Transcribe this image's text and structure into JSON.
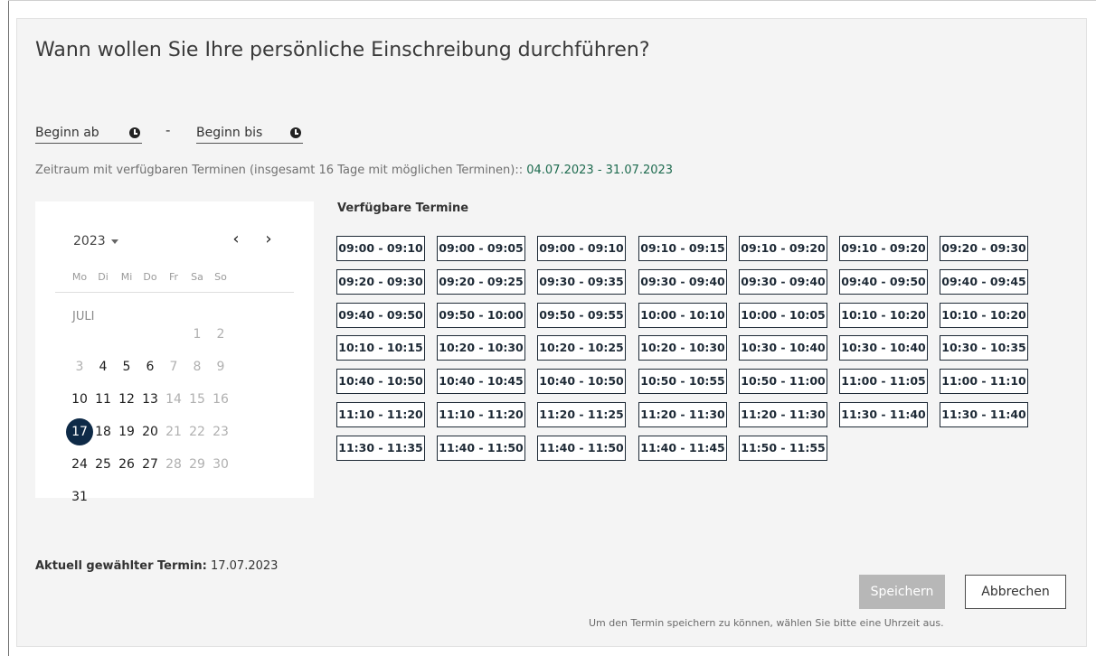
{
  "heading": "Wann wollen Sie Ihre persönliche Einschreibung durchführen?",
  "time_filter": {
    "from_label": "Beginn ab",
    "to_label": "Beginn bis",
    "separator": "-"
  },
  "range_info": {
    "text": "Zeitraum mit verfügbaren Terminen (insgesamt 16 Tage mit möglichen Terminen)::",
    "range": " 04.07.2023 - 31.07.2023"
  },
  "calendar": {
    "year": "2023",
    "prev": "‹",
    "next": "›",
    "weekdays": [
      "Mo",
      "Di",
      "Mi",
      "Do",
      "Fr",
      "Sa",
      "So"
    ],
    "month": "JULI",
    "days": [
      {
        "d": "1",
        "status": "unavailable"
      },
      {
        "d": "2",
        "status": "unavailable"
      },
      {
        "d": "3",
        "status": "unavailable"
      },
      {
        "d": "4",
        "status": "available"
      },
      {
        "d": "5",
        "status": "available"
      },
      {
        "d": "6",
        "status": "available"
      },
      {
        "d": "7",
        "status": "unavailable"
      },
      {
        "d": "8",
        "status": "unavailable"
      },
      {
        "d": "9",
        "status": "unavailable"
      },
      {
        "d": "10",
        "status": "available"
      },
      {
        "d": "11",
        "status": "available"
      },
      {
        "d": "12",
        "status": "available"
      },
      {
        "d": "13",
        "status": "available"
      },
      {
        "d": "14",
        "status": "unavailable"
      },
      {
        "d": "15",
        "status": "unavailable"
      },
      {
        "d": "16",
        "status": "unavailable"
      },
      {
        "d": "17",
        "status": "selected"
      },
      {
        "d": "18",
        "status": "available"
      },
      {
        "d": "19",
        "status": "available"
      },
      {
        "d": "20",
        "status": "available"
      },
      {
        "d": "21",
        "status": "unavailable"
      },
      {
        "d": "22",
        "status": "unavailable"
      },
      {
        "d": "23",
        "status": "unavailable"
      },
      {
        "d": "24",
        "status": "available"
      },
      {
        "d": "25",
        "status": "available"
      },
      {
        "d": "26",
        "status": "available"
      },
      {
        "d": "27",
        "status": "available"
      },
      {
        "d": "28",
        "status": "unavailable"
      },
      {
        "d": "29",
        "status": "unavailable"
      },
      {
        "d": "30",
        "status": "unavailable"
      },
      {
        "d": "31",
        "status": "available"
      }
    ],
    "selected_color": "#0e2a47"
  },
  "slots_title": "Verfügbare Termine",
  "slots": [
    "09:00 - 09:10",
    "09:00 - 09:05",
    "09:00 - 09:10",
    "09:10 - 09:15",
    "09:10 - 09:20",
    "09:10 - 09:20",
    "09:20 - 09:30",
    "09:20 - 09:30",
    "09:20 - 09:25",
    "09:30 - 09:35",
    "09:30 - 09:40",
    "09:30 - 09:40",
    "09:40 - 09:50",
    "09:40 - 09:45",
    "09:40 - 09:50",
    "09:50 - 10:00",
    "09:50 - 09:55",
    "10:00 - 10:10",
    "10:00 - 10:05",
    "10:10 - 10:20",
    "10:10 - 10:20",
    "10:10 - 10:15",
    "10:20 - 10:30",
    "10:20 - 10:25",
    "10:20 - 10:30",
    "10:30 - 10:40",
    "10:30 - 10:40",
    "10:30 - 10:35",
    "10:40 - 10:50",
    "10:40 - 10:45",
    "10:40 - 10:50",
    "10:50 - 10:55",
    "10:50 - 11:00",
    "11:00 - 11:05",
    "11:00 - 11:10",
    "11:10 - 11:20",
    "11:10 - 11:20",
    "11:20 - 11:25",
    "11:20 - 11:30",
    "11:20 - 11:30",
    "11:30 - 11:40",
    "11:30 - 11:40",
    "11:30 - 11:35",
    "11:40 - 11:50",
    "11:40 - 11:50",
    "11:40 - 11:45",
    "11:50 - 11:55"
  ],
  "selected_appointment": {
    "label": "Aktuell gewählter Termin:",
    "value": " 17.07.2023"
  },
  "buttons": {
    "save": "Speichern",
    "cancel": "Abbrechen"
  },
  "hint": "Um den Termin speichern zu können, wählen Sie bitte eine Uhrzeit aus."
}
